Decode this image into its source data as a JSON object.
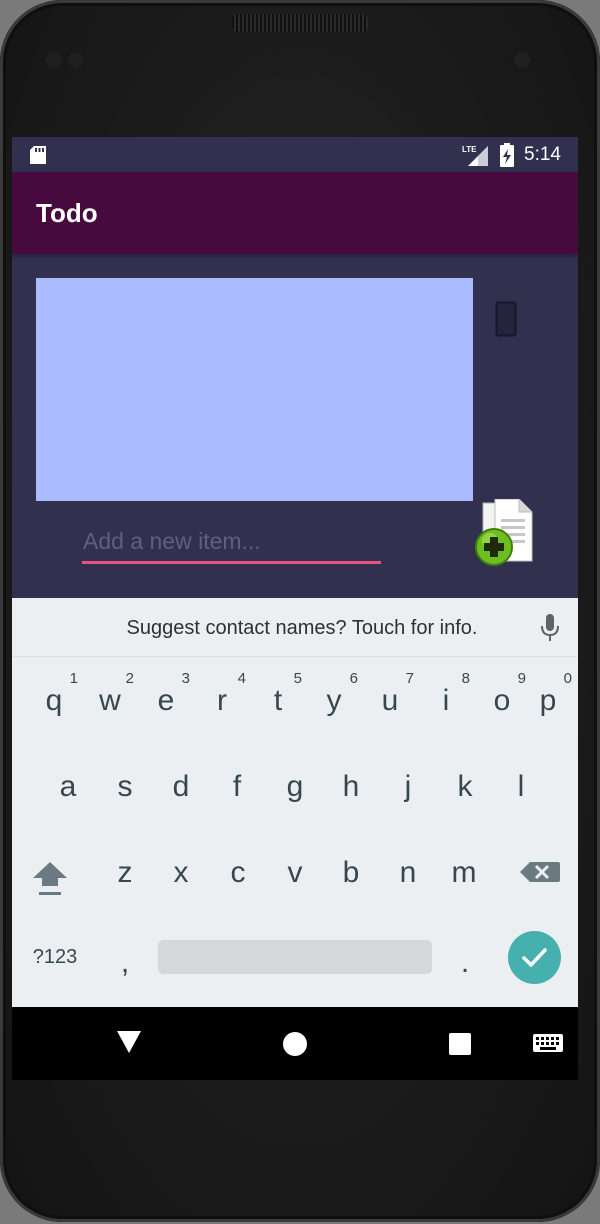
{
  "status_bar": {
    "time": "5:14",
    "network": "LTE"
  },
  "app_bar": {
    "title": "Todo"
  },
  "main": {
    "add_input_placeholder": "Add a new item..."
  },
  "keyboard": {
    "suggestion": "Suggest contact names? Touch for info.",
    "row1": [
      {
        "key": "q",
        "hint": "1"
      },
      {
        "key": "w",
        "hint": "2"
      },
      {
        "key": "e",
        "hint": "3"
      },
      {
        "key": "r",
        "hint": "4"
      },
      {
        "key": "t",
        "hint": "5"
      },
      {
        "key": "y",
        "hint": "6"
      },
      {
        "key": "u",
        "hint": "7"
      },
      {
        "key": "i",
        "hint": "8"
      },
      {
        "key": "o",
        "hint": "9"
      },
      {
        "key": "p",
        "hint": "0"
      }
    ],
    "row2": [
      "a",
      "s",
      "d",
      "f",
      "g",
      "h",
      "j",
      "k",
      "l"
    ],
    "row3": [
      "z",
      "x",
      "c",
      "v",
      "b",
      "n",
      "m"
    ],
    "symbols_label": "?123",
    "comma": ",",
    "period": "."
  },
  "colors": {
    "app_bar": "#470a3f",
    "background": "#31304f",
    "list_box": "#aabcfd",
    "input_underline": "#e8527d",
    "enter_key": "#45b0ad"
  },
  "icons": [
    "sd-card-icon",
    "lte-signal-icon",
    "battery-charging-icon",
    "phone-icon",
    "add-document-icon",
    "mic-icon",
    "shift-icon",
    "backspace-icon",
    "check-icon",
    "back-icon",
    "home-icon",
    "recents-icon",
    "keyboard-icon"
  ]
}
